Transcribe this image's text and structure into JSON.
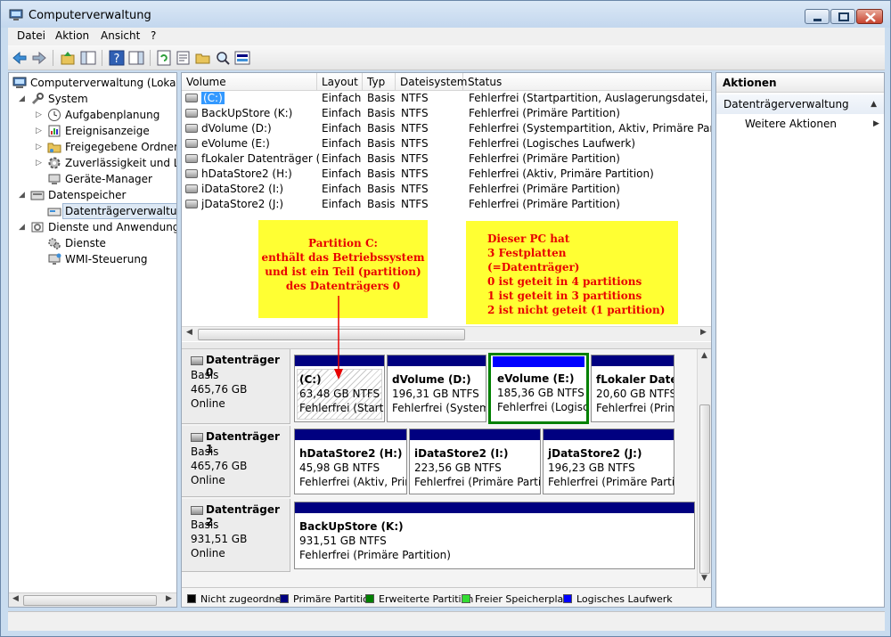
{
  "window": {
    "title": "Computerverwaltung"
  },
  "menu": [
    {
      "label": "Datei"
    },
    {
      "label": "Aktion"
    },
    {
      "label": "Ansicht"
    },
    {
      "label": "?"
    }
  ],
  "tree": {
    "root": "Computerverwaltung (Lokal)",
    "system": "System",
    "aufgaben": "Aufgabenplanung",
    "ereignis": "Ereignisanzeige",
    "freigaben": "Freigegebene Ordner",
    "zuverl": "Zuverlässigkeit und Leis",
    "geraete": "Geräte-Manager",
    "datenspeicher": "Datenspeicher",
    "datentraeger": "Datenträgerverwaltung",
    "dienste_anw": "Dienste und Anwendungen",
    "dienste": "Dienste",
    "wmi": "WMI-Steuerung"
  },
  "columns": {
    "volume": "Volume",
    "layout": "Layout",
    "typ": "Typ",
    "fs": "Dateisystem",
    "status": "Status"
  },
  "volumes": [
    {
      "name": "(C:)",
      "layout": "Einfach",
      "typ": "Basis",
      "fs": "NTFS",
      "status": "Fehlerfrei (Startpartition, Auslagerungsdatei, Absturz"
    },
    {
      "name": "BackUpStore (K:)",
      "layout": "Einfach",
      "typ": "Basis",
      "fs": "NTFS",
      "status": "Fehlerfrei (Primäre Partition)"
    },
    {
      "name": "dVolume (D:)",
      "layout": "Einfach",
      "typ": "Basis",
      "fs": "NTFS",
      "status": "Fehlerfrei (Systempartition, Aktiv, Primäre Partition)"
    },
    {
      "name": "eVolume (E:)",
      "layout": "Einfach",
      "typ": "Basis",
      "fs": "NTFS",
      "status": "Fehlerfrei (Logisches Laufwerk)"
    },
    {
      "name": "fLokaler Datenträger (F:)",
      "layout": "Einfach",
      "typ": "Basis",
      "fs": "NTFS",
      "status": "Fehlerfrei (Primäre Partition)"
    },
    {
      "name": "hDataStore2 (H:)",
      "layout": "Einfach",
      "typ": "Basis",
      "fs": "NTFS",
      "status": "Fehlerfrei (Aktiv, Primäre Partition)"
    },
    {
      "name": "iDataStore2 (I:)",
      "layout": "Einfach",
      "typ": "Basis",
      "fs": "NTFS",
      "status": "Fehlerfrei (Primäre Partition)"
    },
    {
      "name": "jDataStore2 (J:)",
      "layout": "Einfach",
      "typ": "Basis",
      "fs": "NTFS",
      "status": "Fehlerfrei (Primäre Partition)"
    }
  ],
  "notes": {
    "c_lines": [
      "Partition C:",
      "enthält das Betriebssystem",
      "und ist ein Teil (partition)",
      "des Datenträgers 0"
    ],
    "pc_lines": [
      "Dieser PC hat",
      "3 Festplatten",
      "(=Datenträger)",
      "0 ist geteit in 4 partitions",
      "1 ist geteit in 3 partitions",
      "2 ist nicht geteit (1 partition)"
    ]
  },
  "disks": [
    {
      "name": "Datenträger 0",
      "type": "Basis",
      "size": "465,76 GB",
      "state": "Online",
      "parts": [
        {
          "name": "(C:)",
          "size": "63,48 GB NTFS",
          "status": "Fehlerfrei (Startp"
        },
        {
          "name": "dVolume  (D:)",
          "size": "196,31 GB NTFS",
          "status": "Fehlerfrei (Systemp"
        },
        {
          "name": "eVolume  (E:)",
          "size": "185,36 GB NTFS",
          "status": "Fehlerfrei (Logisc"
        },
        {
          "name": "fLokaler Daten",
          "size": "20,60 GB NTFS",
          "status": "Fehlerfrei (Prim"
        }
      ]
    },
    {
      "name": "Datenträger 1",
      "type": "Basis",
      "size": "465,76 GB",
      "state": "Online",
      "parts": [
        {
          "name": "hDataStore2  (H:)",
          "size": "45,98 GB NTFS",
          "status": "Fehlerfrei (Aktiv, Prim"
        },
        {
          "name": "iDataStore2  (I:)",
          "size": "223,56 GB NTFS",
          "status": "Fehlerfrei (Primäre Partiti"
        },
        {
          "name": "jDataStore2  (J:)",
          "size": "196,23 GB NTFS",
          "status": "Fehlerfrei (Primäre Partiti"
        }
      ]
    },
    {
      "name": "Datenträger 2",
      "type": "Basis",
      "size": "931,51 GB",
      "state": "Online",
      "parts": [
        {
          "name": "BackUpStore  (K:)",
          "size": "931,51 GB NTFS",
          "status": "Fehlerfrei (Primäre Partition)"
        }
      ]
    }
  ],
  "legend": [
    {
      "label": "Nicht zugeordnet",
      "color": "#000000"
    },
    {
      "label": "Primäre Partition",
      "color": "#000080"
    },
    {
      "label": "Erweiterte Partition",
      "color": "#008000"
    },
    {
      "label": "Freier Speicherplatz",
      "color": "#33dd33"
    },
    {
      "label": "Logisches Laufwerk",
      "color": "#0000ff"
    }
  ],
  "actions": {
    "title": "Aktionen",
    "section": "Datenträgerverwaltung",
    "more": "Weitere Aktionen"
  },
  "colors": {
    "primary_bar": "#000080",
    "logical_bar": "#0000ff",
    "extended_border": "#008000",
    "note_bg": "#ffff33",
    "note_text": "#e80000"
  }
}
